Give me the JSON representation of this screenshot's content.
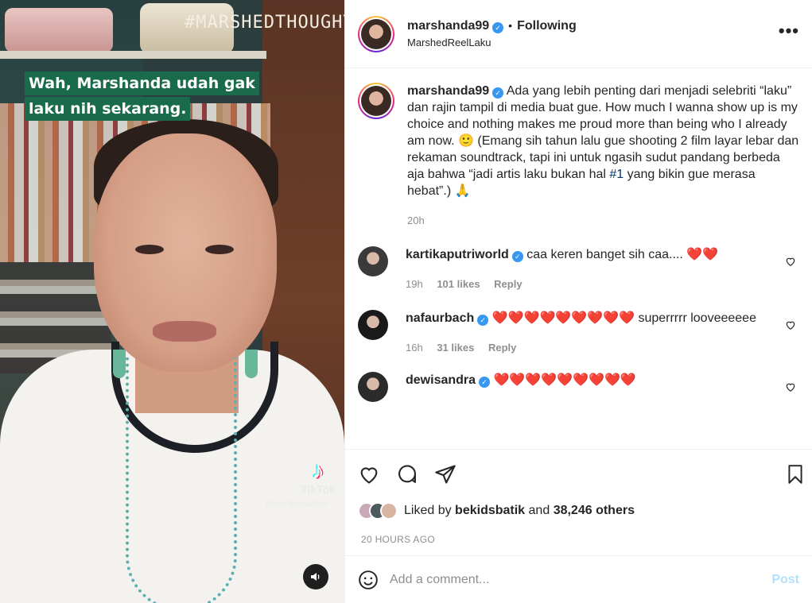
{
  "media": {
    "hashtag": "#MARSHEDTHOUGHT",
    "caption_lines": [
      "Wah, Marshanda udah gak",
      "laku nih sekarang."
    ],
    "tiktok_brand": "TikTok",
    "tiktok_user": "@marshastardust"
  },
  "header": {
    "username": "marshanda99",
    "separator": "•",
    "follow_state": "Following",
    "subtitle": "MarshedReelLaku",
    "more_label": "•••"
  },
  "caption": {
    "username": "marshanda99",
    "text_before_tag": "Ada yang lebih penting dari menjadi selebriti “laku” dan rajin tampil di media buat gue. How much I wanna show up is my choice and nothing makes me proud more than being who I already am now. 🙂 (Emang sih tahun lalu gue shooting 2 film layar lebar dan rekaman soundtrack, tapi ini untuk ngasih sudut pandang berbeda aja bahwa “jadi artis laku bukan hal ",
    "hashtag": "#1",
    "text_after_tag": " yang bikin gue merasa hebat”.) 🙏",
    "time": "20h"
  },
  "comments": [
    {
      "username": "kartikaputriworld",
      "text": "caa keren banget sih caa.... ❤️❤️",
      "time": "19h",
      "likes": "101 likes",
      "reply": "Reply",
      "avatar_color": "#3a3a3a"
    },
    {
      "username": "nafaurbach",
      "text": "❤️❤️❤️❤️❤️❤️❤️❤️❤️ superrrrr looveeeeee",
      "time": "16h",
      "likes": "31 likes",
      "reply": "Reply",
      "avatar_color": "#1a1a1a"
    },
    {
      "username": "dewisandra",
      "text": "❤️❤️❤️❤️❤️❤️❤️❤️❤️",
      "avatar_color": "#2b2b2b"
    }
  ],
  "likes": {
    "prefix": "Liked by",
    "user": "bekidsbatik",
    "middle": "and",
    "others": "38,246 others"
  },
  "timestamp": "20 HOURS AGO",
  "comment_input": {
    "placeholder": "Add a comment...",
    "post_label": "Post"
  },
  "colors": {
    "verified": "#3897f0",
    "caption_bg": "#1a6b4c",
    "post_disabled": "#b2dffc"
  },
  "icons": [
    "heart-icon",
    "comment-icon",
    "share-icon",
    "bookmark-icon",
    "emoji-icon",
    "sound-icon",
    "more-icon",
    "verified-icon"
  ]
}
